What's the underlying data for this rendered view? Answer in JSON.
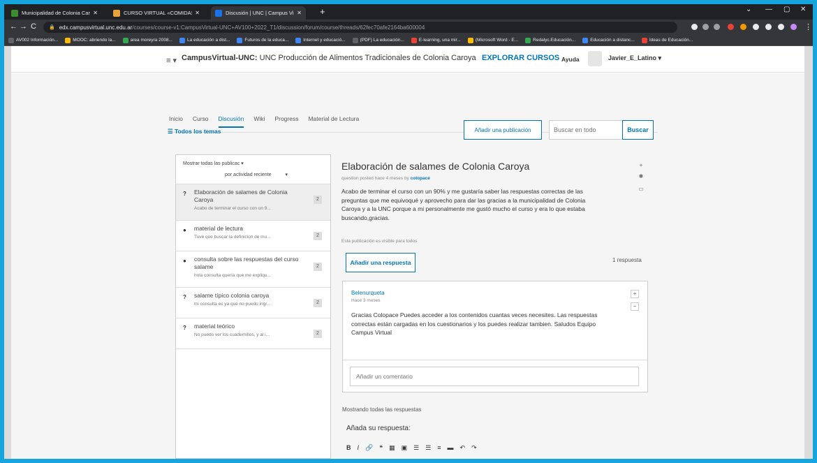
{
  "browser": {
    "tabs": [
      {
        "title": "Municipalidad de Colonia Caroy",
        "favicon_color": "#3c8d2f"
      },
      {
        "title": "CURSO VIRTUAL «COMIDAS TÍPI",
        "favicon_color": "#e8a33d"
      },
      {
        "title": "Discusión | UNC | Campus Virtu",
        "favicon_color": "#1a73e8"
      }
    ],
    "new_tab": "+",
    "window_controls": [
      "⌄",
      "—",
      "▢",
      "✕"
    ],
    "url_host": "edx.campusvirtual.unc.edu.ar",
    "url_path": "/courses/course-v1:CampusVirtual-UNC+AV100+2022_T1/discussion/forum/course/threads/62fec70afe2164ba600004",
    "bookmarks": [
      {
        "label": "AV002 Información...",
        "color": "#5f6368"
      },
      {
        "label": "MOOC: abriendo la...",
        "color": "#fbbc04"
      },
      {
        "label": "area moreyra 2008...",
        "color": "#34a853"
      },
      {
        "label": "La educación a dist...",
        "color": "#4285f4"
      },
      {
        "label": "Futuros de la educa...",
        "color": "#4285f4"
      },
      {
        "label": "Internet y educació...",
        "color": "#4285f4"
      },
      {
        "label": "(PDF) La educación...",
        "color": "#5f6368"
      },
      {
        "label": "E-learning, una mir...",
        "color": "#ea4335"
      },
      {
        "label": "(Microsoft Word - E...",
        "color": "#fbbc04"
      },
      {
        "label": "Redalyc.Educación...",
        "color": "#34a853"
      },
      {
        "label": "Educación a distanc...",
        "color": "#4285f4"
      },
      {
        "label": "Ideas de Educación...",
        "color": "#ea4335"
      }
    ]
  },
  "header": {
    "brand_strong": "CampusVirtual-UNC:",
    "course_name": " UNC Producción de Alimentos Tradicionales de Colonia Caroya",
    "explore": "EXPLORAR CURSOS",
    "help": "Ayuda",
    "username": "Javier_E_Latino ▾"
  },
  "course_nav": [
    "Inicio",
    "Curso",
    "Discusión",
    "Wiki",
    "Progress",
    "Material de Lectura"
  ],
  "discussion": {
    "all_topics": "☰  Todos los temas",
    "add_post": "Añadir una publicación",
    "search_placeholder": "Buscar en todo",
    "search_button": "Buscar",
    "filter_show": "Mostrar todas las publicac ▾",
    "filter_sort": "por actividad reciente",
    "filter_dd": "▾"
  },
  "threads": [
    {
      "icon": "?",
      "title": "Elaboración de salames de Colonia Caroya",
      "snippet": "Acabo de terminar el curso con un 9...",
      "count": "2"
    },
    {
      "icon": "●",
      "title": "material de lectura",
      "snippet": "Tuve que buscar la definicion de mu...",
      "count": "2"
    },
    {
      "icon": "●",
      "title": "consulta sobre las respuestas del curso salame",
      "snippet": "hola consulta quería que me expliqu...",
      "count": "2"
    },
    {
      "icon": "?",
      "title": "salame típico colonia caroya",
      "snippet": "mi consulta es ya que no puedo ingr...",
      "count": "2"
    },
    {
      "icon": "?",
      "title": "material teórico",
      "snippet": "No puedo ver los cuadernillos, y al i...",
      "count": "2"
    }
  ],
  "post": {
    "title": "Elaboración de salames de Colonia Caroya",
    "meta_prefix": "question posted hace 4 meses by ",
    "author": "colopace",
    "body": "Acabo de terminar el curso con un 90% y me gustaría saber las respuestas correctas de las preguntas que me equivoqué y aprovecho para dar las gracias a la municipalidad de Colonia Caroya y a la UNC porque a mi personalmente me gustó mucho el curso y era lo que estaba buscando,gracias.",
    "visibility": "Esta publicación es visible para todos",
    "add_response": "Añadir una respuesta",
    "response_count": "1 respuesta"
  },
  "response": {
    "author": "Belenurqueta",
    "time": "Hace 3 meses",
    "body": "Gracias Colopace Puedes acceder a los contenidos cuantas veces necesites. Las respuestas correctas están cargadas en los cuestionarios y los puedes realizar tambien. Saludos Equipo Campus Virtual",
    "comment_placeholder": "Añadir un comentario"
  },
  "footer": {
    "showing": "Mostrando todas las respuestas",
    "your_reply": "Añada su respuesta:",
    "editor_tools": [
      "B",
      "I",
      "🔗",
      "❝",
      "▦",
      "▣",
      "☰",
      "☰",
      "≡",
      "▬",
      "↶",
      "↷"
    ]
  }
}
